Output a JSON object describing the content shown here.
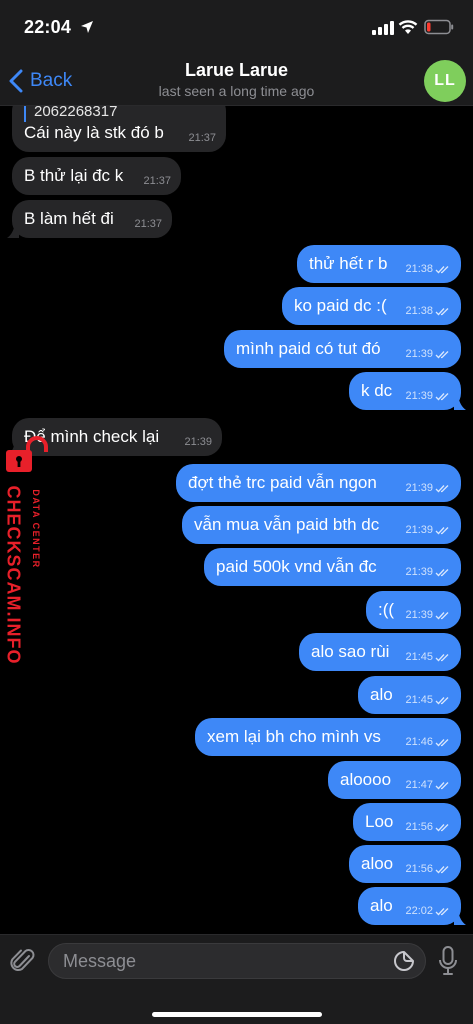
{
  "status_bar": {
    "time": "22:04"
  },
  "header": {
    "back_label": "Back",
    "title": "Larue Larue",
    "subtitle": "last seen a long time ago",
    "avatar_initials": "LL",
    "avatar_color": "#7fce5c"
  },
  "colors": {
    "outgoing": "#3e88f7",
    "incoming": "#262628",
    "accent": "#3e88f7",
    "watermark": "#e8202a"
  },
  "messages": [
    {
      "dir": "in",
      "reply": "2062268317",
      "text": "Cái này là stk đó b",
      "time": "21:37"
    },
    {
      "dir": "in",
      "text": "B thử lại đc k",
      "time": "21:37"
    },
    {
      "dir": "in",
      "text": "B làm hết đi",
      "time": "21:37"
    },
    {
      "dir": "out",
      "text": "thử hết r b",
      "time": "21:38"
    },
    {
      "dir": "out",
      "text": "ko paid dc :(",
      "time": "21:38"
    },
    {
      "dir": "out",
      "text": "mình paid có tut đó",
      "time": "21:39"
    },
    {
      "dir": "out",
      "text": "k dc",
      "time": "21:39"
    },
    {
      "dir": "in",
      "text": "Để mình check lại",
      "time": "21:39"
    },
    {
      "dir": "out",
      "text": "đợt thẻ trc paid vẫn ngon",
      "time": "21:39"
    },
    {
      "dir": "out",
      "text": "vẫn mua vẫn paid bth dc",
      "time": "21:39"
    },
    {
      "dir": "out",
      "text": "paid 500k vnd vẫn đc",
      "time": "21:39"
    },
    {
      "dir": "out",
      "text": ":((",
      "time": "21:39"
    },
    {
      "dir": "out",
      "text": "alo sao rùi",
      "time": "21:45"
    },
    {
      "dir": "out",
      "text": "alo",
      "time": "21:45"
    },
    {
      "dir": "out",
      "text": "xem lại bh cho mình vs",
      "time": "21:46"
    },
    {
      "dir": "out",
      "text": "aloooo",
      "time": "21:47"
    },
    {
      "dir": "out",
      "text": "Loo",
      "time": "21:56"
    },
    {
      "dir": "out",
      "text": "aloo",
      "time": "21:56"
    },
    {
      "dir": "out",
      "text": "alo",
      "time": "22:02"
    }
  ],
  "watermark": {
    "brand": "CHECKSCAM.INFO",
    "sub": "DATA CENTER"
  },
  "composer": {
    "placeholder": "Message",
    "value": ""
  }
}
